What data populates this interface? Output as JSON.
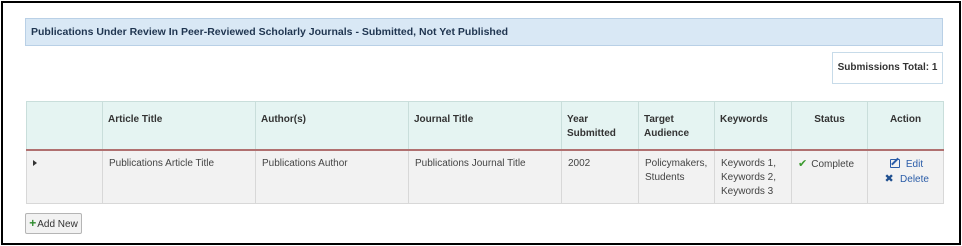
{
  "panel": {
    "title": "Publications Under Review In Peer-Reviewed Scholarly Journals - Submitted, Not Yet Published"
  },
  "summary": {
    "total_label": "Submissions Total: 1"
  },
  "table": {
    "columns": [
      "",
      "Article Title",
      "Author(s)",
      "Journal Title",
      "Year Submitted",
      "Target Audience",
      "Keywords",
      "Status",
      "Action"
    ],
    "rows": [
      {
        "article_title": "Publications Article Title",
        "authors": "Publications Author",
        "journal_title": "Publications Journal Title",
        "year_submitted": "2002",
        "target_audience": "Policymakers, Students",
        "keywords": "Keywords 1, Keywords 2, Keywords 3",
        "status": "Complete",
        "actions": {
          "edit": "Edit",
          "delete": "Delete"
        }
      }
    ]
  },
  "buttons": {
    "add_new": "Add New"
  },
  "colors": {
    "header_bg": "#d9e8f5",
    "table_header_bg": "#e5f4f2",
    "header_rule": "#b07070",
    "status_ok": "#3a9a2e",
    "link": "#2a5ca8"
  },
  "icons": {
    "expand": "caret-right-icon",
    "status": "check-icon",
    "edit": "edit-icon",
    "delete": "x-icon",
    "add": "plus-icon"
  }
}
